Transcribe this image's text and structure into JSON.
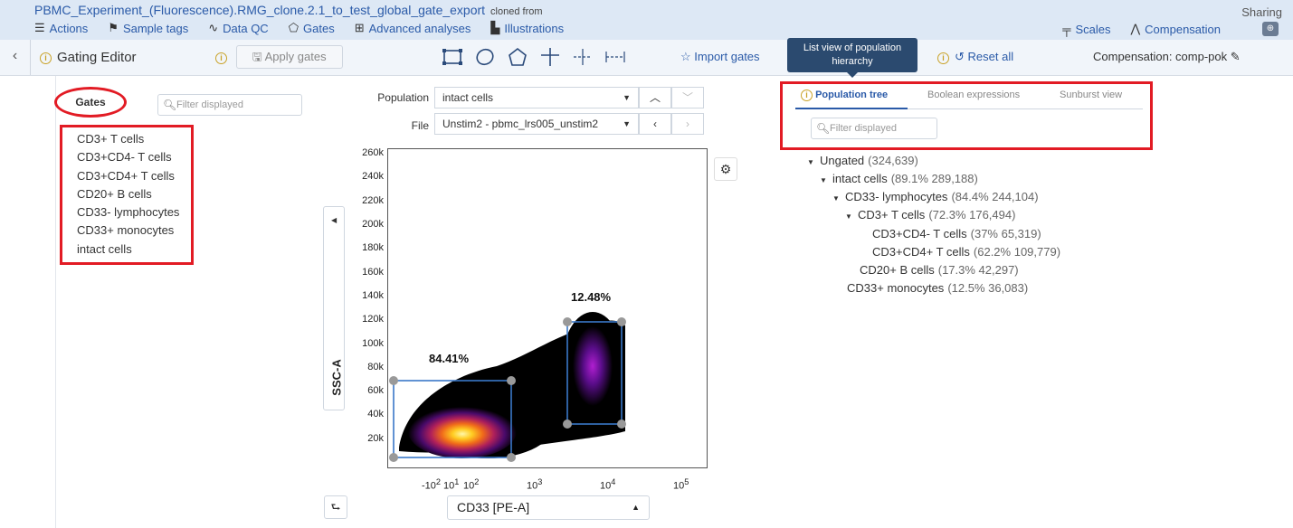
{
  "header": {
    "experiment_title": "PBMC_Experiment_(Fluorescence).RMG_clone.2.1_to_test_global_gate_export",
    "cloned_from": "cloned from",
    "sharing": "Sharing",
    "menu": [
      {
        "label": "Actions",
        "icon": "hamburger-icon"
      },
      {
        "label": "Sample tags",
        "icon": "tag-icon"
      },
      {
        "label": "Data QC",
        "icon": "pulse-icon"
      },
      {
        "label": "Gates",
        "icon": "pentagon-icon"
      },
      {
        "label": "Advanced analyses",
        "icon": "hierarchy-icon"
      },
      {
        "label": "Illustrations",
        "icon": "bar-chart-icon"
      }
    ],
    "right_menu": [
      {
        "label": "Scales",
        "icon": "scales-icon"
      },
      {
        "label": "Compensation",
        "icon": "compensation-icon"
      }
    ]
  },
  "toolbar": {
    "title": "Gating Editor",
    "apply_gates": "Apply gates",
    "import_gates": "Import gates",
    "tooltip": "List view of population hierarchy",
    "reset_all": "Reset all",
    "compensation": "Compensation: comp-pok"
  },
  "gates_panel": {
    "header": "Gates",
    "filter_placeholder": "Filter displayed",
    "items": [
      "CD3+ T cells",
      "CD3+CD4- T cells",
      "CD3+CD4+ T cells",
      "CD20+ B cells",
      "CD33- lymphocytes",
      "CD33+ monocytes",
      "intact cells"
    ]
  },
  "plot_controls": {
    "population_label": "Population",
    "population_value": "intact cells",
    "file_label": "File",
    "file_value": "Unstim2 - pbmc_lrs005_unstim2",
    "y_axis": "SSC-A",
    "x_axis": "CD33 [PE-A]",
    "y_ticks": [
      "260k",
      "240k",
      "220k",
      "200k",
      "180k",
      "160k",
      "140k",
      "120k",
      "100k",
      "80k",
      "60k",
      "40k",
      "20k"
    ],
    "x_ticks": [
      "-10",
      "10",
      "10",
      "10",
      "10",
      "10"
    ],
    "x_tick_exp": [
      "2",
      "1",
      "2",
      "3",
      "4",
      "5"
    ],
    "gate1_pct": "84.41%",
    "gate2_pct": "12.48%"
  },
  "tree_panel": {
    "tabs": [
      "Population tree",
      "Boolean expressions",
      "Sunburst view"
    ],
    "filter_placeholder": "Filter displayed",
    "nodes": [
      {
        "label": "Ungated",
        "count": "(324,639)"
      },
      {
        "label": "intact cells",
        "count": "(89.1%  289,188)"
      },
      {
        "label": "CD33- lymphocytes",
        "count": "(84.4%  244,104)"
      },
      {
        "label": "CD3+ T cells",
        "count": "(72.3%  176,494)"
      },
      {
        "label": "CD3+CD4- T cells",
        "count": "(37%  65,319)"
      },
      {
        "label": "CD3+CD4+ T cells",
        "count": "(62.2%  109,779)"
      },
      {
        "label": "CD20+ B cells",
        "count": "(17.3%  42,297)"
      },
      {
        "label": "CD33+ monocytes",
        "count": "(12.5%  36,083)"
      }
    ]
  }
}
